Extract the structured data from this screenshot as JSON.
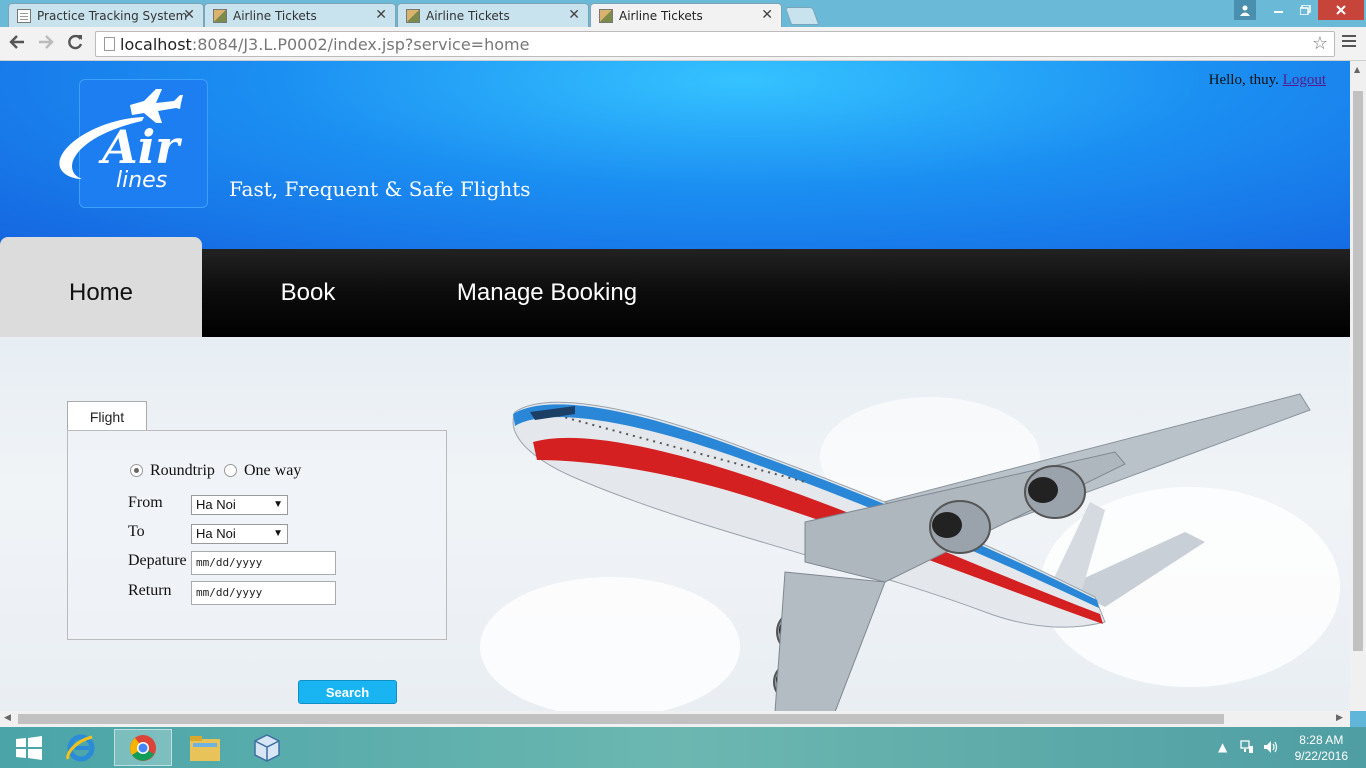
{
  "browser": {
    "tabs": [
      {
        "title": "Practice Tracking System",
        "icon": "document-icon",
        "active": false
      },
      {
        "title": "Airline Tickets",
        "icon": "image-icon",
        "active": false
      },
      {
        "title": "Airline Tickets",
        "icon": "image-icon",
        "active": false
      },
      {
        "title": "Airline Tickets",
        "icon": "image-icon",
        "active": true
      }
    ],
    "close_glyph": "✕",
    "address": {
      "host": "localhost",
      "path": ":8084/J3.L.P0002/index.jsp?service=home"
    }
  },
  "header": {
    "logo_text": "Air lines",
    "tagline": "Fast, Frequent & Safe Flights",
    "greeting": "Hello, thuy.",
    "logout_label": "Logout"
  },
  "nav": {
    "items": [
      {
        "label": "Home",
        "active": true
      },
      {
        "label": "Book",
        "active": false
      },
      {
        "label": "Manage Booking",
        "active": false
      }
    ]
  },
  "search_form": {
    "tab_label": "Flight",
    "trip_types": [
      {
        "label": "Roundtrip",
        "checked": true
      },
      {
        "label": "One way",
        "checked": false
      }
    ],
    "from_label": "From",
    "from_value": "Ha Noi",
    "to_label": "To",
    "to_value": "Ha Noi",
    "departure_label": "Depature",
    "departure_placeholder": "mm/dd/yyyy",
    "return_label": "Return",
    "return_placeholder": "mm/dd/yyyy",
    "search_label": "Search"
  },
  "taskbar": {
    "apps": [
      "windows-start-icon",
      "internet-explorer-icon",
      "chrome-icon",
      "file-explorer-icon",
      "virtualbox-icon"
    ],
    "time": "8:28 AM",
    "date": "9/22/2016"
  },
  "colors": {
    "header_blue": "#1b8ff2",
    "nav_black": "#000000",
    "search_button": "#18b5f2",
    "plane_red": "#d42020"
  }
}
